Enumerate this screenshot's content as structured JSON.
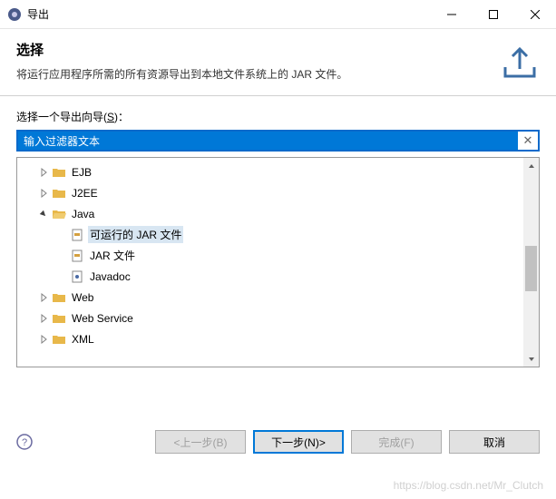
{
  "titlebar": {
    "title": "导出"
  },
  "header": {
    "heading": "选择",
    "description": "将运行应用程序所需的所有资源导出到本地文件系统上的 JAR 文件。"
  },
  "content": {
    "prompt_prefix": "选择一个导出向导(",
    "prompt_key": "S",
    "prompt_suffix": ")：",
    "filter_placeholder": "输入过滤器文本"
  },
  "tree": {
    "items": [
      {
        "label": "EJB",
        "expanded": false,
        "level": 1,
        "kind": "folder"
      },
      {
        "label": "J2EE",
        "expanded": false,
        "level": 1,
        "kind": "folder"
      },
      {
        "label": "Java",
        "expanded": true,
        "level": 1,
        "kind": "folder-open"
      },
      {
        "label": "可运行的 JAR 文件",
        "level": 2,
        "kind": "jar",
        "selected": true
      },
      {
        "label": "JAR 文件",
        "level": 2,
        "kind": "jar"
      },
      {
        "label": "Javadoc",
        "level": 2,
        "kind": "doc"
      },
      {
        "label": "Web",
        "expanded": false,
        "level": 1,
        "kind": "folder"
      },
      {
        "label": "Web Service",
        "expanded": false,
        "level": 1,
        "kind": "folder"
      },
      {
        "label": "XML",
        "expanded": false,
        "level": 1,
        "kind": "folder"
      }
    ]
  },
  "footer": {
    "back": "<上一步(B)",
    "next": "下一步(N)>",
    "finish": "完成(F)",
    "cancel": "取消"
  },
  "watermark": "https://blog.csdn.net/Mr_Clutch"
}
